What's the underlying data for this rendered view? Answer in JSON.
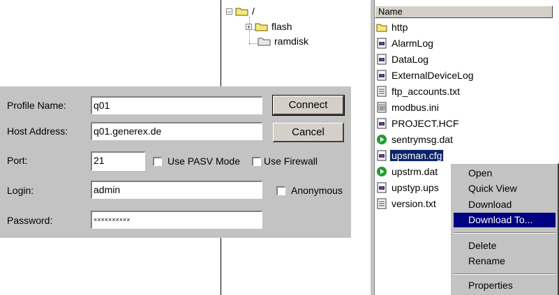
{
  "tree": {
    "root": {
      "label": "/",
      "toggle": "⊟"
    },
    "children": [
      {
        "label": "flash",
        "toggle": "+"
      },
      {
        "label": "ramdisk"
      }
    ]
  },
  "dialog": {
    "profile_name_label": "Profile Name:",
    "profile_name_value": "q01",
    "host_address_label": "Host Address:",
    "host_address_value": "q01.generex.de",
    "port_label": "Port:",
    "port_value": "21",
    "use_pasv_label": "Use PASV Mode",
    "use_firewall_label": "Use Firewall",
    "login_label": "Login:",
    "login_value": "admin",
    "anonymous_label": "Anonymous",
    "password_label": "Password:",
    "password_value": "××××××××××",
    "connect_label": "Connect",
    "cancel_label": "Cancel"
  },
  "file_list": {
    "column_header": "Name",
    "items": [
      {
        "name": "http",
        "icon": "folder-icon"
      },
      {
        "name": "AlarmLog",
        "icon": "log-file-icon"
      },
      {
        "name": "DataLog",
        "icon": "log-file-icon"
      },
      {
        "name": "ExternalDeviceLog",
        "icon": "log-file-icon"
      },
      {
        "name": "ftp_accounts.txt",
        "icon": "text-file-icon"
      },
      {
        "name": "modbus.ini",
        "icon": "ini-file-icon"
      },
      {
        "name": "PROJECT.HCF",
        "icon": "log-file-icon"
      },
      {
        "name": "sentrymsg.dat",
        "icon": "green-play-icon"
      },
      {
        "name": "upsman.cfg",
        "icon": "log-file-icon",
        "selected": true
      },
      {
        "name": "upstrm.dat",
        "icon": "green-play-icon"
      },
      {
        "name": "upstyp.ups",
        "icon": "log-file-icon"
      },
      {
        "name": "version.txt",
        "icon": "text-file-icon"
      }
    ]
  },
  "context_menu": {
    "items": [
      "Open",
      "Quick View",
      "Download",
      "Download To...",
      "Delete",
      "Rename",
      "Properties"
    ],
    "highlighted": "Download To..."
  },
  "colors": {
    "dialog_bg": "#c3c3c3",
    "selection": "#0a246a",
    "menu_highlight": "#000080"
  }
}
